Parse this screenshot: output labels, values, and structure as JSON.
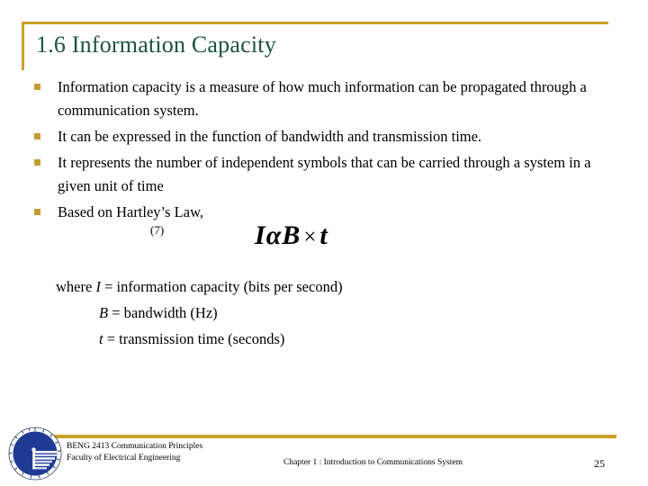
{
  "slide": {
    "title": "1.6 Information Capacity",
    "title_color": "#1c5240",
    "accent_color": "#c9a227",
    "bullet_color": "#c49a33",
    "background_color": "#ffffff"
  },
  "bullets": [
    {
      "text": "Information capacity is a measure of how much information can be propagated through a communication system."
    },
    {
      "text": "It can be expressed in the function of bandwidth and transmission time."
    },
    {
      "text": "It represents the number of independent symbols that can be carried through a system in a given unit of time"
    },
    {
      "text": "Based on Hartley’s Law,"
    }
  ],
  "formula": {
    "number": "(7)",
    "variable_i": "I",
    "alpha": "α",
    "variable_b": "B",
    "operator": "×",
    "variable_t": "t",
    "plain": "I α B × t"
  },
  "definitions": {
    "lead": "where ",
    "rows": [
      {
        "symbol": "I",
        "text": " = information capacity (bits per second)"
      },
      {
        "symbol": "B",
        "text": " = bandwidth (Hz)"
      },
      {
        "symbol": "t",
        "text": " = transmission time (seconds)"
      }
    ]
  },
  "footer": {
    "course": "BENG 2413 Communication Principles",
    "faculty": "Faculty of Electrical Engineering",
    "chapter": "Chapter 1 : Introduction to Communications System",
    "page_number": "25",
    "logo_name": "university-seal-logo",
    "logo_color": "#1f3a93"
  }
}
